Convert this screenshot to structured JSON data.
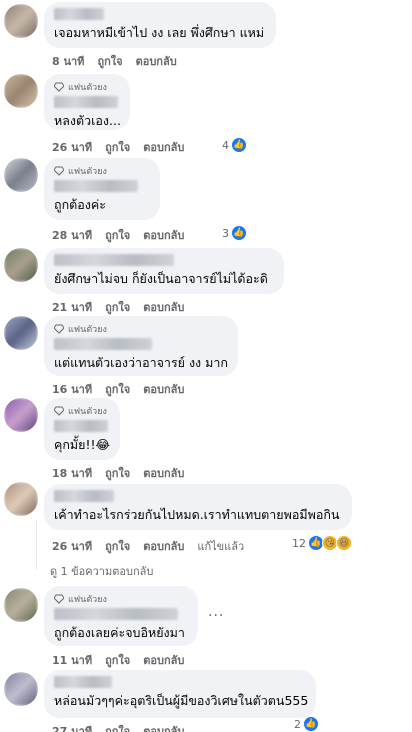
{
  "fan_badge": "แฟนตัวยง",
  "actions": {
    "like": "ถูกใจ",
    "reply": "ตอบกลับ",
    "edited": "แก้ไขแล้ว"
  },
  "comments": [
    {
      "text": "เจอมหาหมีเข้าไป งง เลย พึ่งศึกษา แหม่",
      "time": "8 นาที",
      "reactions": ""
    },
    {
      "text": "หลงตัวเอง...",
      "time": "26 นาที",
      "reactions": "4"
    },
    {
      "text": "ถูกต้องค่ะ",
      "time": "28 นาที",
      "reactions": "3"
    },
    {
      "text": "ยังศึกษาไม่จบ ก็ยังเป็นอาจารย์ไม่ได้อะดิ",
      "time": "21 นาที",
      "reactions": ""
    },
    {
      "text": "แต่แทนตัวเองว่าอาจารย์ งง มาก",
      "time": "16 นาที",
      "reactions": ""
    },
    {
      "text": "คุกมั้ย!!😂",
      "time": "18 นาที",
      "reactions": ""
    },
    {
      "text": "เค้าทำอะไรกร่วยกันไปหมด.เราทำแทบตายพอมีพอกิน",
      "time": "26 นาที",
      "reactions": "12"
    },
    {
      "text": "ถูกต้องเลยค่ะจบอิหยังมา",
      "time": "11 นาที",
      "reactions": ""
    },
    {
      "text": "หล่อนมัวๆๆค่ะอุตริเป็นผู้มีของวิเศษในตัวตน555",
      "time": "27 นาที",
      "reactions": "2"
    }
  ],
  "view_replies": "ดู 1 ข้อความตอบกลับ",
  "more_icon": "...",
  "colors": {
    "like_blue": "#1877f2",
    "bubble": "#f0f2f5",
    "meta": "#65676b"
  }
}
